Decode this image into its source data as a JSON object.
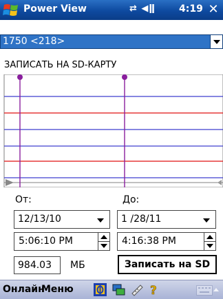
{
  "titlebar": {
    "title": "Power View",
    "time": "4:19",
    "status_icons": "⇄ ◀ǁ",
    "close_label": "✕"
  },
  "device_select": {
    "value": "1750 <218>"
  },
  "section_label": "ЗАПИСАТЬ НА SD-КАРТУ",
  "range": {
    "from_label": "От:",
    "to_label": "До:",
    "from_date": "12/13/10",
    "to_date": "1 /28/11",
    "from_time": "5:06:10 PM",
    "to_time": "4:16:38 PM"
  },
  "size": {
    "value": "984.03",
    "unit": "МБ"
  },
  "write_button_label": "Записать на SD",
  "menubar": {
    "left_label": "Онлайн",
    "right_label": "Меню"
  },
  "colors": {
    "titlebar": "#0e4a9f",
    "select_bg": "#2f73c6",
    "chart_line_blue": "#3f3fcf",
    "chart_line_red": "#e01010",
    "marker_purple": "#8a1f9e",
    "menubar": "#b5bedc"
  },
  "icons": [
    "windows-start-icon",
    "power-view-app-icon",
    "network-icon",
    "ruler-icon",
    "help-icon",
    "keyboard-icon"
  ]
}
